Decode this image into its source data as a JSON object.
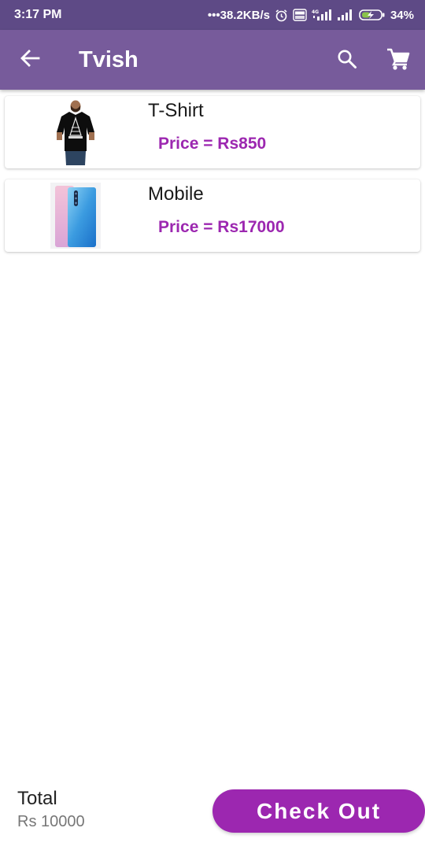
{
  "status_bar": {
    "time": "3:17 PM",
    "network_speed": "•••38.2KB/s",
    "battery": "34%",
    "icons": [
      "alarm-icon",
      "volte-icon",
      "4g-signal-icon",
      "signal-icon",
      "battery-charging-icon"
    ]
  },
  "app_bar": {
    "title": "Tvish",
    "icons": [
      "back-arrow-icon",
      "search-icon",
      "cart-icon"
    ],
    "color": "#775b9b"
  },
  "products": [
    {
      "name": "T-Shirt",
      "price": "Price = Rs850",
      "image": "tshirt-image"
    },
    {
      "name": "Mobile",
      "price": "Price = Rs17000",
      "image": "mobile-image"
    }
  ],
  "footer": {
    "total_label": "Total",
    "total_value": "Rs 10000",
    "checkout_label": "Check Out"
  },
  "colors": {
    "accent": "#9c27b0",
    "status_bar": "#5e4a86",
    "app_bar": "#775b9b"
  }
}
